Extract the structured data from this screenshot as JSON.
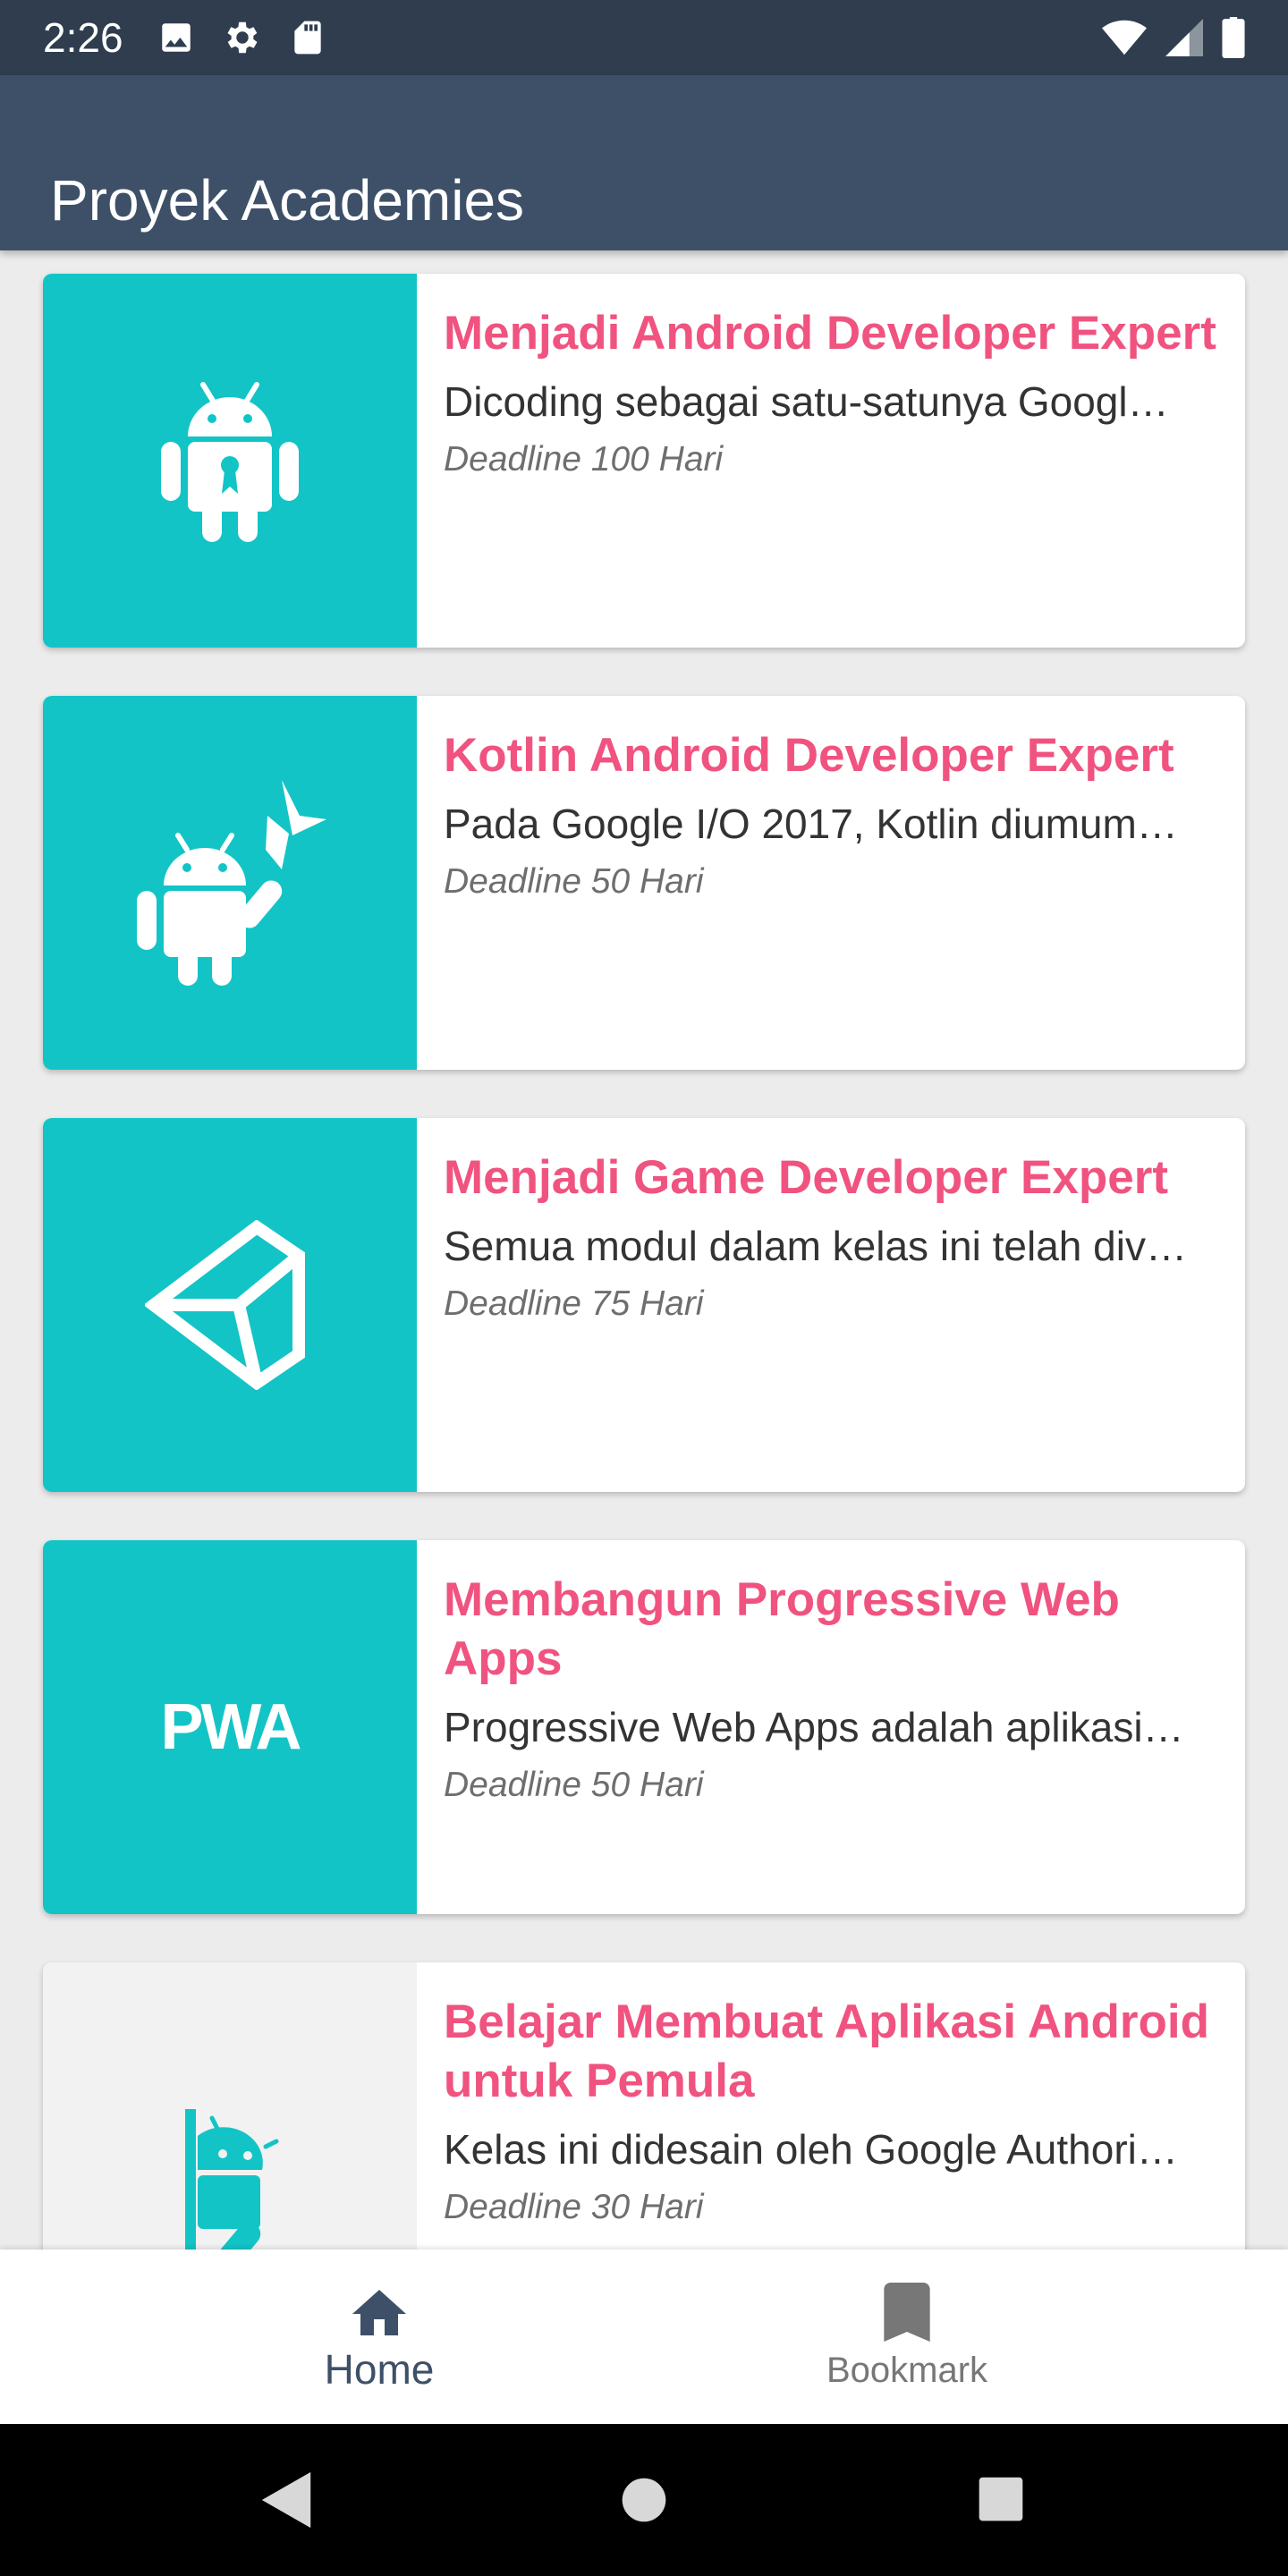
{
  "status_bar": {
    "time": "2:26",
    "icons": [
      "image-icon",
      "gear-icon",
      "sd-card-icon",
      "wifi-icon",
      "signal-icon",
      "battery-icon"
    ]
  },
  "app_bar": {
    "title": "Proyek Academies"
  },
  "colors": {
    "status_bar": "#2f3d4f",
    "app_bar": "#3d5068",
    "accent": "#f0537f",
    "teal": "#13c4c6",
    "light_tile": "#f2f2f2"
  },
  "courses": [
    {
      "title": "Menjadi Android Developer Expert",
      "description": "Dicoding sebagai satu-satunya Googl…",
      "deadline": "Deadline 100 Hari",
      "icon": "android-expert-icon"
    },
    {
      "title": "Kotlin Android Developer Expert",
      "description": "Pada Google I/O 2017, Kotlin diumum…",
      "deadline": "Deadline 50 Hari",
      "icon": "kotlin-android-icon"
    },
    {
      "title": "Menjadi Game Developer Expert",
      "description": "Semua modul dalam kelas ini telah div…",
      "deadline": "Deadline 75 Hari",
      "icon": "unity-icon"
    },
    {
      "title": "Membangun Progressive Web Apps",
      "description": "Progressive Web Apps adalah aplikasi…",
      "deadline": "Deadline 50 Hari",
      "icon": "pwa-icon",
      "logo_text": "PWA"
    },
    {
      "title": "Belajar Membuat Aplikasi Android untuk Pemula",
      "description": "Kelas ini didesain oleh Google Authori…",
      "deadline": "Deadline 30 Hari",
      "icon": "android-beginner-icon"
    }
  ],
  "bottom_nav": {
    "home_label": "Home",
    "bookmark_label": "Bookmark",
    "selected": "Home"
  },
  "system_nav": {
    "icons": [
      "back-icon",
      "home-circle-icon",
      "recents-icon"
    ]
  }
}
